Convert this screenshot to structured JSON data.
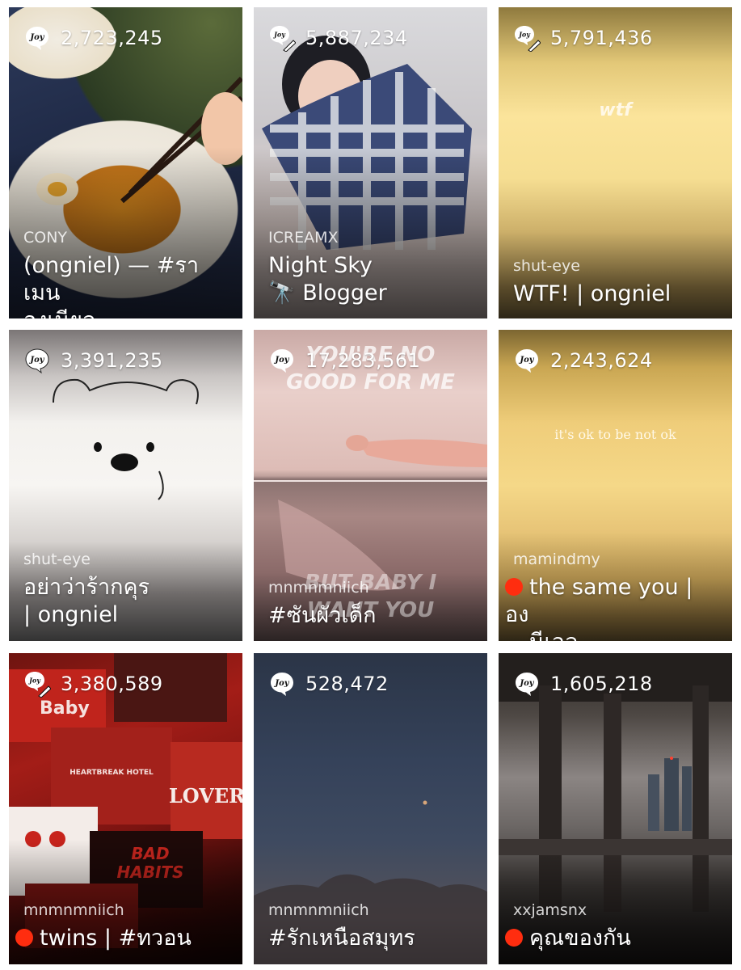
{
  "cards": [
    {
      "views": "2,723,245",
      "author": "CONY",
      "title_line1": "(ongniel) — #ราเมน",
      "title_line2": "องเนียล",
      "badge": "joy-icon"
    },
    {
      "views": "5,887,234",
      "author": "ICREAMX",
      "title_line1": "Night Sky",
      "title_line2": "🔭 Blogger",
      "badge": "joy-pen-icon"
    },
    {
      "views": "5,791,436",
      "author": "shut-eye",
      "title_line1": "WTF! | ongniel",
      "cover_text": "wtf",
      "badge": "joy-pen-icon"
    },
    {
      "views": "3,391,235",
      "author": "shut-eye",
      "title_line1": "อย่าว่าร้ากคุร",
      "title_line2": "| ongniel",
      "badge": "joy-icon"
    },
    {
      "views": "17,283,561",
      "author": "mnmnmniich",
      "title_line1": "#ซันผัวเด็ก",
      "cover_text_top": "YOU'RE NO GOOD FOR ME",
      "cover_text_bottom": "BUT BABY I WANT YOU",
      "badge": "joy-icon"
    },
    {
      "views": "2,243,624",
      "author": "mamindmy",
      "title_line1": "the same you | อง",
      "title_line2": "นีเอล",
      "cover_text": "it's ok to be not ok",
      "badge": "joy-icon",
      "dot": true
    },
    {
      "views": "3,380,589",
      "author": "mnmnmniich",
      "title_line1": "twins | #ทวอน",
      "badge": "joy-pen-icon",
      "dot": true,
      "collage_words": [
        "Baby",
        "HEARTBREAK HOTEL",
        "LOVER",
        "BAD HABITS"
      ]
    },
    {
      "views": "528,472",
      "author": "mnmnmniich",
      "title_line1": "#รักเหนือสมุทร",
      "badge": "joy-icon"
    },
    {
      "views": "1,605,218",
      "author": "xxjamsnx",
      "title_line1": "คุณของกัน",
      "badge": "joy-icon",
      "dot": true
    }
  ],
  "badge_label": "Joy",
  "colors": {
    "status_dot": "#ff2d0f",
    "text": "#ffffff"
  }
}
